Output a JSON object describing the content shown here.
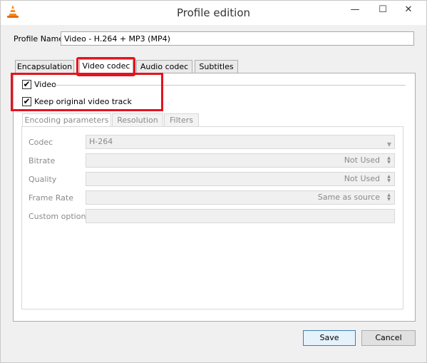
{
  "window": {
    "title": "Profile edition",
    "minimize_glyph": "—",
    "maximize_glyph": "☐",
    "close_glyph": "✕",
    "app_icon": "vlc-cone-icon"
  },
  "profile": {
    "label": "Profile Name",
    "value": "Video - H.264 + MP3 (MP4)"
  },
  "tabs": [
    {
      "label": "Encapsulation",
      "active": false
    },
    {
      "label": "Video codec",
      "active": true
    },
    {
      "label": "Audio codec",
      "active": false
    },
    {
      "label": "Subtitles",
      "active": false
    }
  ],
  "video": {
    "video_checkbox": {
      "label": "Video",
      "checked": true
    },
    "keep_original_checkbox": {
      "label": "Keep original video track",
      "checked": true
    },
    "check_glyph": "✔"
  },
  "inner_tabs": [
    {
      "label": "Encoding parameters",
      "active": true
    },
    {
      "label": "Resolution",
      "active": false
    },
    {
      "label": "Filters",
      "active": false
    }
  ],
  "encoding": {
    "codec": {
      "label": "Codec",
      "value": "H-264"
    },
    "bitrate": {
      "label": "Bitrate",
      "value": "Not Used"
    },
    "quality": {
      "label": "Quality",
      "value": "Not Used"
    },
    "frame_rate": {
      "label": "Frame Rate",
      "value": "Same as source"
    },
    "custom_options": {
      "label": "Custom options",
      "value": ""
    }
  },
  "buttons": {
    "save": "Save",
    "cancel": "Cancel"
  },
  "colors": {
    "highlight": "#e3141e",
    "disabled_text": "#8a8a8a",
    "default_button_border": "#3c7fb1"
  }
}
